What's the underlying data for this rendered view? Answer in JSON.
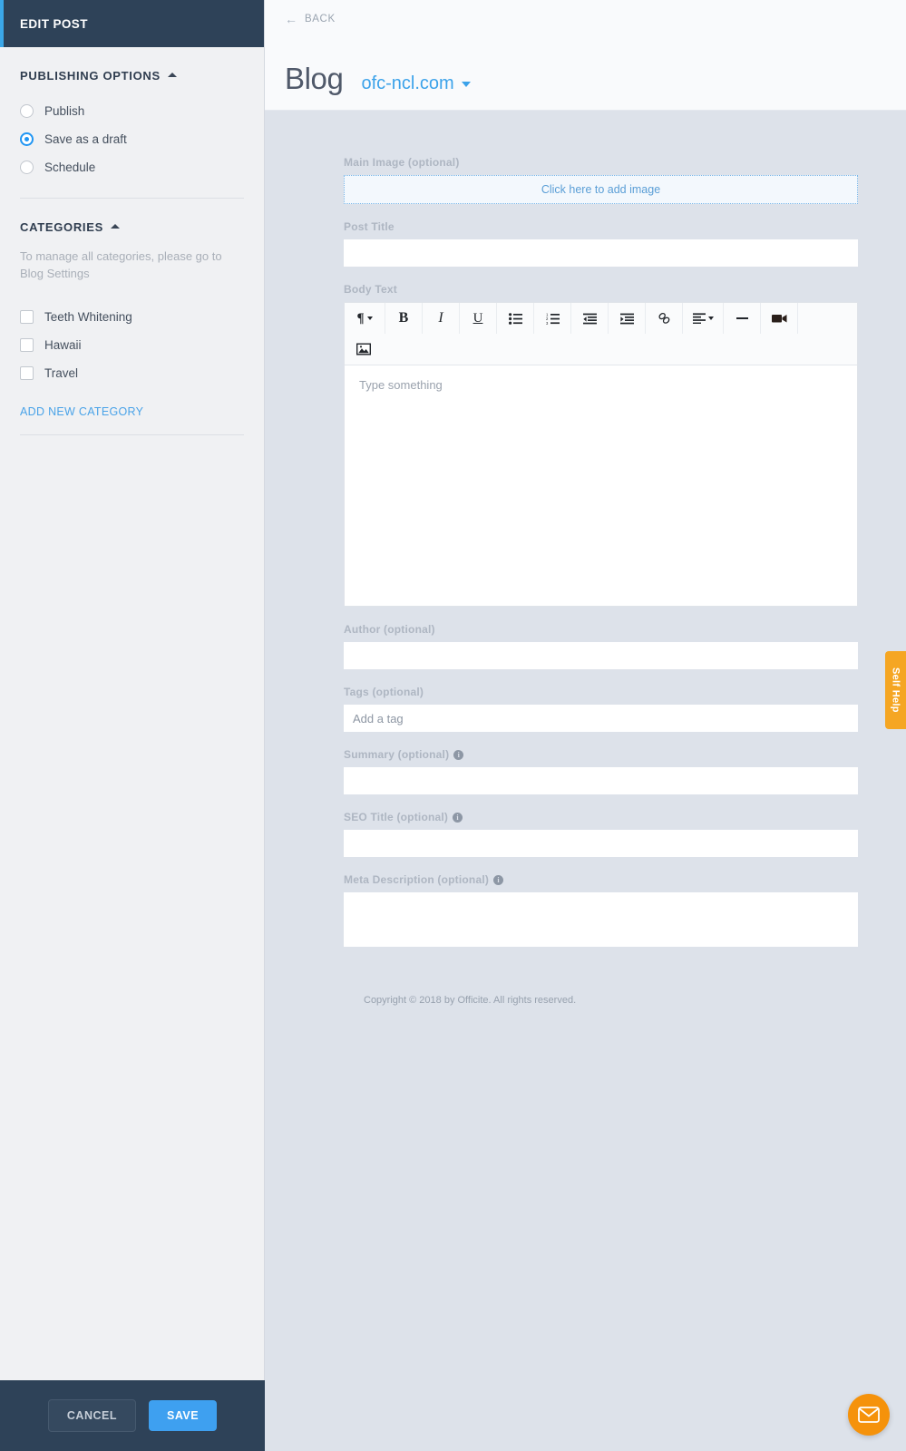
{
  "sidebar": {
    "header_title": "EDIT POST",
    "publishing": {
      "section_title": "PUBLISHING OPTIONS",
      "options": [
        {
          "label": "Publish",
          "selected": false
        },
        {
          "label": "Save as a draft",
          "selected": true
        },
        {
          "label": "Schedule",
          "selected": false
        }
      ]
    },
    "categories": {
      "section_title": "CATEGORIES",
      "note": "To manage all categories, please go to Blog Settings",
      "items": [
        {
          "label": "Teeth Whitening",
          "checked": false
        },
        {
          "label": "Hawaii",
          "checked": false
        },
        {
          "label": "Travel",
          "checked": false
        }
      ],
      "add_new_label": "ADD NEW CATEGORY"
    }
  },
  "bottombar": {
    "cancel_label": "CANCEL",
    "save_label": "SAVE"
  },
  "header": {
    "back_label": "BACK",
    "title": "Blog",
    "domain": "ofc-ncl.com"
  },
  "form": {
    "main_image": {
      "label": "Main Image (optional)",
      "dropzone_text": "Click here to add image"
    },
    "post_title": {
      "label": "Post Title",
      "value": "",
      "placeholder": ""
    },
    "body_text": {
      "label": "Body Text",
      "placeholder": "Type something",
      "value": "",
      "toolbar": [
        {
          "name": "paragraph-format",
          "glyph": "¶",
          "caret": true
        },
        {
          "name": "bold",
          "glyph": "B",
          "caret": false
        },
        {
          "name": "italic",
          "glyph": "I",
          "caret": false
        },
        {
          "name": "underline",
          "glyph": "U",
          "caret": false
        },
        {
          "name": "unordered-list",
          "glyph": "",
          "caret": false
        },
        {
          "name": "ordered-list",
          "glyph": "",
          "caret": false
        },
        {
          "name": "outdent",
          "glyph": "",
          "caret": false
        },
        {
          "name": "indent",
          "glyph": "",
          "caret": false
        },
        {
          "name": "insert-link",
          "glyph": "",
          "caret": false
        },
        {
          "name": "align",
          "glyph": "",
          "caret": true
        },
        {
          "name": "horizontal-rule",
          "glyph": "",
          "caret": false
        },
        {
          "name": "insert-video",
          "glyph": "",
          "caret": false
        },
        {
          "name": "insert-image",
          "glyph": "",
          "caret": false
        }
      ]
    },
    "author": {
      "label": "Author (optional)",
      "value": "",
      "placeholder": ""
    },
    "tags": {
      "label": "Tags (optional)",
      "value": "",
      "placeholder": "Add a tag"
    },
    "summary": {
      "label": "Summary (optional)",
      "has_info": true,
      "value": "",
      "placeholder": ""
    },
    "seo_title": {
      "label": "SEO Title (optional)",
      "has_info": true,
      "value": "",
      "placeholder": ""
    },
    "meta_description": {
      "label": "Meta Description (optional)",
      "has_info": true,
      "value": "",
      "placeholder": ""
    },
    "info_glyph": "i"
  },
  "footer": {
    "copyright": "Copyright © 2018 by Officite. All rights reserved."
  },
  "widgets": {
    "self_help_label": "Self Help",
    "chat_icon": "envelope-icon"
  },
  "colors": {
    "sidebar_header_bg": "#2e4258",
    "accent_blue": "#3ba7e8",
    "save_button": "#3ea0f0",
    "link_blue": "#4aa3e8",
    "self_help_orange": "#f5a623",
    "chat_orange": "#f5920b",
    "page_bg": "#dde2ea"
  }
}
